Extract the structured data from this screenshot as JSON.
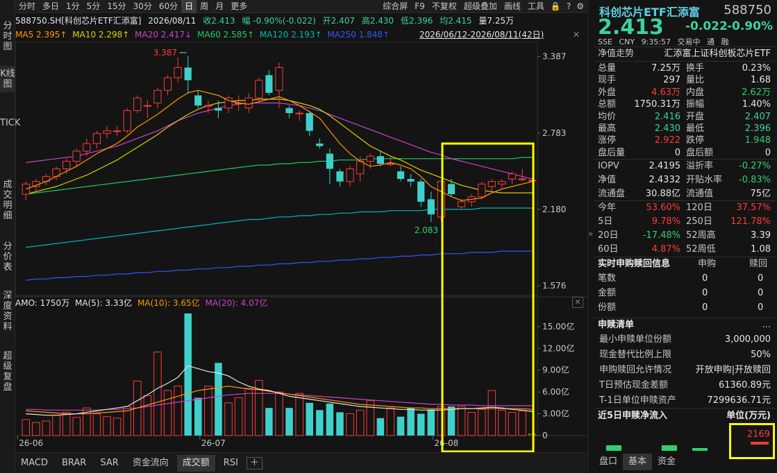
{
  "nav": {
    "items": [
      "分时图",
      "K线图",
      "TICK",
      "成交明细",
      "分价表",
      "深度资料",
      "超级复盘"
    ]
  },
  "toolbar": {
    "items": [
      "分时",
      "多日",
      "1分",
      "5分",
      "15分",
      "30分",
      "60分",
      "日",
      "周",
      "月",
      "更多"
    ],
    "active": "日",
    "right_items": [
      "综合屏",
      "F9",
      "不复权",
      "超级叠加",
      "画线",
      "工具"
    ]
  },
  "info": {
    "code_name": "588750.SH[科创芯片ETF汇添富]",
    "date": "2026/08/11",
    "close": "收2.413",
    "amplitude_change": "幅 -0.90%(-0.022)",
    "open": "开2.407",
    "high": "高2.430",
    "low": "低2.396",
    "avg": "均2.415",
    "volume": "量7.25万"
  },
  "ma": {
    "ma5": "MA5 2.395↑",
    "ma10": "MA10 2.298↑",
    "ma20": "MA20 2.417↓",
    "ma60": "MA60 2.585↑",
    "ma120": "MA120 2.193↑",
    "ma250": "MA250 1.848↑",
    "range": "2026/06/12-2026/08/11(42日)"
  },
  "amo": {
    "label": "AMO: 1750万",
    "ma5": "MA(5): 3.33亿",
    "ma10": "MA(10): 3.65亿",
    "ma20": "MA(20): 4.07亿"
  },
  "price_axis": [
    "3.387",
    "2.783",
    "2.180",
    "1.576"
  ],
  "vol_axis": [
    "15.00亿",
    "12.00亿",
    "9.00亿",
    "6.00亿",
    "3.00亿",
    "0"
  ],
  "date_axis": [
    "26-06",
    "26-07",
    "26-08"
  ],
  "annotations": {
    "high": "3.387",
    "low": "2.083"
  },
  "chart_data": {
    "type": "candlestick",
    "dates_labels": [
      "26-06",
      "26-07",
      "26-08"
    ],
    "ylim": [
      1.576,
      3.387
    ],
    "candles": [
      {
        "o": 2.3,
        "h": 2.4,
        "l": 2.25,
        "c": 2.38
      },
      {
        "o": 2.36,
        "h": 2.42,
        "l": 2.32,
        "c": 2.4
      },
      {
        "o": 2.4,
        "h": 2.46,
        "l": 2.37,
        "c": 2.44
      },
      {
        "o": 2.44,
        "h": 2.52,
        "l": 2.41,
        "c": 2.5
      },
      {
        "o": 2.5,
        "h": 2.58,
        "l": 2.46,
        "c": 2.56
      },
      {
        "o": 2.56,
        "h": 2.66,
        "l": 2.52,
        "c": 2.64
      },
      {
        "o": 2.64,
        "h": 2.74,
        "l": 2.6,
        "c": 2.7
      },
      {
        "o": 2.7,
        "h": 2.8,
        "l": 2.66,
        "c": 2.78
      },
      {
        "o": 2.78,
        "h": 2.84,
        "l": 2.74,
        "c": 2.8
      },
      {
        "o": 2.8,
        "h": 2.84,
        "l": 2.76,
        "c": 2.8
      },
      {
        "o": 2.8,
        "h": 2.98,
        "l": 2.78,
        "c": 2.96
      },
      {
        "o": 2.96,
        "h": 3.08,
        "l": 2.94,
        "c": 3.06
      },
      {
        "o": 3.0,
        "h": 3.04,
        "l": 2.9,
        "c": 3.0
      },
      {
        "o": 3.02,
        "h": 3.14,
        "l": 2.98,
        "c": 3.12
      },
      {
        "o": 3.12,
        "h": 3.24,
        "l": 3.08,
        "c": 3.22
      },
      {
        "o": 3.22,
        "h": 3.38,
        "l": 3.18,
        "c": 3.3
      },
      {
        "o": 3.3,
        "h": 3.39,
        "l": 3.1,
        "c": 3.2
      },
      {
        "o": 3.08,
        "h": 3.12,
        "l": 2.98,
        "c": 3.0
      },
      {
        "o": 3.0,
        "h": 3.04,
        "l": 2.94,
        "c": 3.0
      },
      {
        "o": 2.98,
        "h": 3.04,
        "l": 2.9,
        "c": 2.96
      },
      {
        "o": 2.98,
        "h": 3.08,
        "l": 2.94,
        "c": 3.06
      },
      {
        "o": 3.02,
        "h": 3.08,
        "l": 2.96,
        "c": 3.02
      },
      {
        "o": 2.98,
        "h": 3.1,
        "l": 2.94,
        "c": 3.06
      },
      {
        "o": 3.06,
        "h": 3.22,
        "l": 3.02,
        "c": 3.2
      },
      {
        "o": 3.24,
        "h": 3.28,
        "l": 3.08,
        "c": 3.1
      },
      {
        "o": 3.12,
        "h": 3.34,
        "l": 2.98,
        "c": 3.3
      },
      {
        "o": 2.98,
        "h": 3.0,
        "l": 2.9,
        "c": 2.94
      },
      {
        "o": 2.94,
        "h": 2.96,
        "l": 2.88,
        "c": 2.94
      },
      {
        "o": 2.94,
        "h": 2.96,
        "l": 2.76,
        "c": 2.8
      },
      {
        "o": 2.7,
        "h": 2.74,
        "l": 2.66,
        "c": 2.68
      },
      {
        "o": 2.62,
        "h": 2.66,
        "l": 2.38,
        "c": 2.5
      },
      {
        "o": 2.48,
        "h": 2.5,
        "l": 2.36,
        "c": 2.4
      },
      {
        "o": 2.4,
        "h": 2.52,
        "l": 2.36,
        "c": 2.5
      },
      {
        "o": 2.46,
        "h": 2.6,
        "l": 2.4,
        "c": 2.56
      },
      {
        "o": 2.56,
        "h": 2.62,
        "l": 2.5,
        "c": 2.6
      },
      {
        "o": 2.6,
        "h": 2.64,
        "l": 2.52,
        "c": 2.54
      },
      {
        "o": 2.54,
        "h": 2.6,
        "l": 2.52,
        "c": 2.54
      },
      {
        "o": 2.48,
        "h": 2.52,
        "l": 2.4,
        "c": 2.42
      },
      {
        "o": 2.42,
        "h": 2.46,
        "l": 2.36,
        "c": 2.4
      },
      {
        "o": 2.4,
        "h": 2.42,
        "l": 2.2,
        "c": 2.24
      },
      {
        "o": 2.26,
        "h": 2.32,
        "l": 2.08,
        "c": 2.14
      },
      {
        "o": 2.12,
        "h": 2.4,
        "l": 2.08,
        "c": 2.4
      },
      {
        "o": 2.38,
        "h": 2.42,
        "l": 2.28,
        "c": 2.3
      },
      {
        "o": 2.2,
        "h": 2.26,
        "l": 2.18,
        "c": 2.24
      },
      {
        "o": 2.24,
        "h": 2.3,
        "l": 2.2,
        "c": 2.28
      },
      {
        "o": 2.28,
        "h": 2.4,
        "l": 2.26,
        "c": 2.38
      },
      {
        "o": 2.36,
        "h": 2.42,
        "l": 2.32,
        "c": 2.4
      },
      {
        "o": 2.38,
        "h": 2.42,
        "l": 2.34,
        "c": 2.4
      },
      {
        "o": 2.42,
        "h": 2.48,
        "l": 2.38,
        "c": 2.46
      },
      {
        "o": 2.42,
        "h": 2.5,
        "l": 2.4,
        "c": 2.42
      },
      {
        "o": 2.41,
        "h": 2.43,
        "l": 2.4,
        "c": 2.41
      }
    ],
    "ma5": [
      2.34,
      2.37,
      2.4,
      2.44,
      2.48,
      2.52,
      2.57,
      2.62,
      2.66,
      2.7,
      2.76,
      2.83,
      2.88,
      2.93,
      2.99,
      3.05,
      3.1,
      3.12,
      3.1,
      3.08,
      3.04,
      3.02,
      3.01,
      3.03,
      3.05,
      3.07,
      3.04,
      3.0,
      2.95,
      2.9,
      2.8,
      2.7,
      2.62,
      2.56,
      2.52,
      2.53,
      2.55,
      2.53,
      2.5,
      2.44,
      2.36,
      2.32,
      2.28,
      2.25,
      2.26,
      2.27,
      2.31,
      2.34,
      2.36,
      2.38,
      2.4
    ],
    "ma10": [
      2.3,
      2.32,
      2.34,
      2.36,
      2.39,
      2.42,
      2.45,
      2.49,
      2.53,
      2.57,
      2.62,
      2.67,
      2.72,
      2.77,
      2.83,
      2.88,
      2.93,
      2.97,
      3.0,
      3.02,
      3.03,
      3.04,
      3.04,
      3.05,
      3.05,
      3.05,
      3.04,
      3.02,
      3.0,
      2.97,
      2.92,
      2.86,
      2.8,
      2.74,
      2.68,
      2.64,
      2.6,
      2.57,
      2.53,
      2.49,
      2.46,
      2.43,
      2.4,
      2.37,
      2.35,
      2.33,
      2.32,
      2.31,
      2.31,
      2.31,
      2.31
    ],
    "ma20": [
      2.55,
      2.56,
      2.57,
      2.58,
      2.59,
      2.6,
      2.62,
      2.64,
      2.66,
      2.68,
      2.71,
      2.74,
      2.77,
      2.8,
      2.84,
      2.88,
      2.91,
      2.94,
      2.96,
      2.98,
      3.0,
      3.01,
      3.02,
      3.02,
      3.02,
      3.02,
      3.01,
      3.0,
      2.98,
      2.96,
      2.93,
      2.9,
      2.87,
      2.84,
      2.81,
      2.78,
      2.75,
      2.72,
      2.69,
      2.66,
      2.63,
      2.61,
      2.58,
      2.56,
      2.54,
      2.52,
      2.5,
      2.48,
      2.46,
      2.44,
      2.42
    ],
    "ma60": [
      2.3,
      2.31,
      2.32,
      2.33,
      2.34,
      2.35,
      2.36,
      2.37,
      2.38,
      2.39,
      2.4,
      2.41,
      2.42,
      2.43,
      2.44,
      2.45,
      2.46,
      2.47,
      2.48,
      2.49,
      2.5,
      2.51,
      2.52,
      2.53,
      2.53,
      2.54,
      2.54,
      2.55,
      2.55,
      2.56,
      2.56,
      2.57,
      2.57,
      2.57,
      2.58,
      2.58,
      2.58,
      2.58,
      2.58,
      2.58,
      2.58,
      2.58,
      2.58,
      2.58,
      2.58,
      2.58,
      2.58,
      2.58,
      2.58,
      2.59,
      2.59
    ],
    "ma120": [
      1.88,
      1.89,
      1.9,
      1.91,
      1.92,
      1.93,
      1.94,
      1.95,
      1.96,
      1.97,
      1.98,
      1.99,
      2.0,
      2.01,
      2.02,
      2.03,
      2.04,
      2.05,
      2.06,
      2.07,
      2.08,
      2.09,
      2.1,
      2.1,
      2.11,
      2.12,
      2.12,
      2.13,
      2.13,
      2.14,
      2.14,
      2.15,
      2.15,
      2.16,
      2.16,
      2.16,
      2.17,
      2.17,
      2.17,
      2.17,
      2.18,
      2.18,
      2.18,
      2.18,
      2.18,
      2.19,
      2.19,
      2.19,
      2.19,
      2.19,
      2.19
    ],
    "ma250": [
      1.62,
      1.63,
      1.63,
      1.64,
      1.64,
      1.65,
      1.65,
      1.66,
      1.66,
      1.67,
      1.67,
      1.68,
      1.68,
      1.69,
      1.69,
      1.7,
      1.7,
      1.71,
      1.71,
      1.72,
      1.72,
      1.73,
      1.73,
      1.74,
      1.74,
      1.75,
      1.75,
      1.76,
      1.76,
      1.77,
      1.77,
      1.78,
      1.78,
      1.79,
      1.79,
      1.8,
      1.8,
      1.81,
      1.81,
      1.82,
      1.82,
      1.83,
      1.83,
      1.83,
      1.84,
      1.84,
      1.84,
      1.85,
      1.85,
      1.85,
      1.85
    ],
    "volumes": [
      2.2,
      1.8,
      2.0,
      2.8,
      3.2,
      2.5,
      3.8,
      3.0,
      2.6,
      2.4,
      4.0,
      7.5,
      5.5,
      11.5,
      6.2,
      6.8,
      16.8,
      5.2,
      6.8,
      10.0,
      4.5,
      5.2,
      6.5,
      7.6,
      3.8,
      6.0,
      3.8,
      5.8,
      4.5,
      3.5,
      4.4,
      3.2,
      3.0,
      3.5,
      4.8,
      2.4,
      3.8,
      2.6,
      3.8,
      3.0,
      3.6,
      4.0,
      4.0,
      4.0,
      3.2,
      3.6,
      6.2,
      3.5,
      3.2,
      3.4,
      0.2
    ],
    "amo_ma5": [
      3.0,
      2.9,
      2.8,
      2.8,
      2.9,
      3.0,
      3.2,
      3.4,
      3.6,
      3.8,
      4.0,
      4.8,
      5.6,
      6.5,
      7.2,
      8.0,
      9.6,
      9.2,
      8.8,
      8.6,
      8.2,
      7.4,
      6.8,
      6.4,
      6.2,
      5.8,
      5.4,
      5.2,
      5.0,
      4.8,
      4.6,
      4.4,
      4.2,
      4.0,
      3.9,
      3.8,
      3.7,
      3.6,
      3.6,
      3.5,
      3.5,
      3.5,
      3.6,
      3.7,
      3.7,
      3.8,
      3.9,
      3.8,
      3.6,
      3.5,
      3.3
    ],
    "amo_ma10": [
      3.4,
      3.3,
      3.2,
      3.1,
      3.0,
      3.0,
      3.0,
      3.1,
      3.2,
      3.3,
      3.4,
      3.8,
      4.2,
      4.6,
      5.0,
      5.4,
      5.8,
      6.2,
      6.4,
      6.6,
      6.8,
      6.6,
      6.4,
      6.3,
      6.1,
      5.9,
      5.7,
      5.5,
      5.3,
      5.1,
      4.9,
      4.7,
      4.5,
      4.3,
      4.2,
      4.1,
      4.0,
      3.9,
      3.8,
      3.8,
      3.7,
      3.7,
      3.7,
      3.7,
      3.7,
      3.7,
      3.7,
      3.7,
      3.7,
      3.7,
      3.6
    ],
    "amo_ma20": [
      3.6,
      3.6,
      3.5,
      3.5,
      3.5,
      3.5,
      3.5,
      3.5,
      3.6,
      3.6,
      3.7,
      3.8,
      4.0,
      4.2,
      4.4,
      4.6,
      4.8,
      5.0,
      5.2,
      5.4,
      5.6,
      5.7,
      5.8,
      5.8,
      5.8,
      5.8,
      5.7,
      5.6,
      5.5,
      5.4,
      5.3,
      5.2,
      5.1,
      5.0,
      4.9,
      4.8,
      4.7,
      4.6,
      4.5,
      4.4,
      4.3,
      4.3,
      4.2,
      4.2,
      4.2,
      4.1,
      4.1,
      4.1,
      4.1,
      4.1,
      4.1
    ]
  },
  "right": {
    "title": "科创芯片ETF汇添富",
    "code": "588750",
    "price": "2.413",
    "change": "-0.022",
    "pct": "-0.90%",
    "sub": [
      "SSE",
      "CNY",
      "9:35:57",
      "交易中",
      "通",
      "融"
    ],
    "nav_label": "净值走势",
    "nav_value": "汇添富上证科创板芯片ETF",
    "rows": [
      [
        "总量",
        "7.25万",
        "换手",
        "0.23%"
      ],
      [
        "现手",
        "297",
        "量比",
        "1.68"
      ],
      [
        "外盘",
        "4.63万",
        "内盘",
        "2.62万"
      ],
      [
        "总额",
        "1750.31万",
        "振幅",
        "1.40%"
      ],
      [
        "均价",
        "2.416",
        "开盘",
        "2.407"
      ],
      [
        "最高",
        "2.430",
        "最低",
        "2.396"
      ],
      [
        "涨停",
        "2.922",
        "跌停",
        "1.948"
      ],
      [
        "盘后量",
        "0",
        "盘后额",
        "0"
      ]
    ],
    "rows2": [
      [
        "IOPV",
        "2.4195",
        "溢折率",
        "-0.27%"
      ],
      [
        "净值",
        "2.4332",
        "开贴水率",
        "-0.83%"
      ],
      [
        "流通盘",
        "30.88亿",
        "流通值",
        "75亿"
      ]
    ],
    "rows3": [
      [
        "今年",
        "53.60%",
        "120日",
        "37.57%"
      ],
      [
        "5日",
        "9.78%",
        "250日",
        "121.78%"
      ],
      [
        "20日",
        "-17.48%",
        "52周高",
        "3.39"
      ],
      [
        "60日",
        "4.87%",
        "52周低",
        "1.08"
      ]
    ],
    "subscription": {
      "header": "实时申购赎回信息",
      "col1": "申购",
      "col2": "赎回",
      "rows": [
        [
          "笔数",
          "0",
          "0"
        ],
        [
          "金额",
          "0",
          "0"
        ],
        [
          "份额",
          "0",
          "0"
        ]
      ]
    },
    "list": {
      "header": "申赎清单",
      "more": "...",
      "rows": [
        [
          "最小申赎单位份额",
          "3,000,000"
        ],
        [
          "现金替代比例上限",
          "50%"
        ],
        [
          "申购赎回允许情况",
          "开放申购|开放赎回"
        ],
        [
          "T日预估现金差额",
          "61360.89元"
        ],
        [
          "T-1日单位申赎资产",
          "7299636.71元"
        ]
      ]
    },
    "flow": {
      "header": "近5日申赎净流入",
      "unit": "单位(万元)",
      "value": "2169"
    },
    "tabs": [
      "盘口",
      "基本",
      "资金"
    ],
    "active_tab": "基本"
  },
  "bottom_tabs": [
    "MACD",
    "BRAR",
    "SAR",
    "资金流向",
    "成交额",
    "RSI"
  ],
  "bottom_active": "成交额",
  "colors": {
    "up": "#ff3b3b",
    "down": "#3fd0cc",
    "ma5": "#ff9900",
    "ma10": "#d6d600",
    "ma20": "#cc44cc",
    "ma60": "#22cc66",
    "ma120": "#00b8b8",
    "ma250": "#3355ff",
    "highlight": "#ffff00"
  }
}
